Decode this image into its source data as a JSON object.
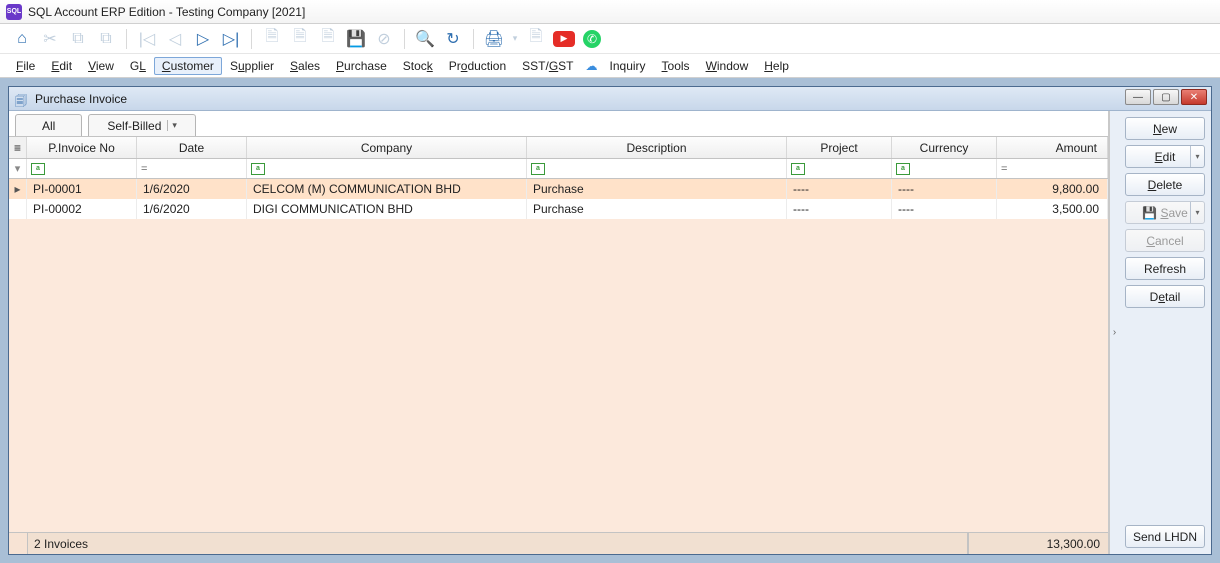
{
  "window": {
    "title": "SQL Account ERP Edition - Testing Company [2021]",
    "icon_label": "SQL"
  },
  "menubar": [
    {
      "label": "File",
      "ul": "F"
    },
    {
      "label": "Edit",
      "ul": "E"
    },
    {
      "label": "View",
      "ul": "V"
    },
    {
      "label": "GL",
      "ul": "L"
    },
    {
      "label": "Customer",
      "ul": "C",
      "active": true
    },
    {
      "label": "Supplier",
      "ul": "u"
    },
    {
      "label": "Sales",
      "ul": "S"
    },
    {
      "label": "Purchase",
      "ul": "P"
    },
    {
      "label": "Stock",
      "ul": "k"
    },
    {
      "label": "Production",
      "ul": "o"
    },
    {
      "label": "SST/GST",
      "ul": "G"
    },
    {
      "label": "Inquiry",
      "ul": ""
    },
    {
      "label": "Tools",
      "ul": "T"
    },
    {
      "label": "Window",
      "ul": "W"
    },
    {
      "label": "Help",
      "ul": "H"
    }
  ],
  "inner_window": {
    "title": "Purchase Invoice"
  },
  "tabs": {
    "all": "All",
    "selfbilled": "Self-Billed"
  },
  "columns": [
    "P.Invoice No",
    "Date",
    "Company",
    "Description",
    "Project",
    "Currency",
    "Amount"
  ],
  "rows": [
    {
      "no": "PI-00001",
      "date": "1/6/2020",
      "company": "CELCOM (M) COMMUNICATION BHD",
      "desc": "Purchase",
      "project": "----",
      "currency": "----",
      "amount": "9,800.00",
      "selected": true
    },
    {
      "no": "PI-00002",
      "date": "1/6/2020",
      "company": "DIGI COMMUNICATION BHD",
      "desc": "Purchase",
      "project": "----",
      "currency": "----",
      "amount": "3,500.00",
      "selected": false
    }
  ],
  "footer": {
    "count_text": "2 Invoices",
    "total": "13,300.00"
  },
  "actions": {
    "new": "New",
    "edit": "Edit",
    "delete": "Delete",
    "save": "Save",
    "cancel": "Cancel",
    "refresh": "Refresh",
    "detail": "Detail",
    "send_lhdn": "Send LHDN"
  },
  "icons": {
    "filter_eq": "=",
    "funnel": "▼"
  }
}
